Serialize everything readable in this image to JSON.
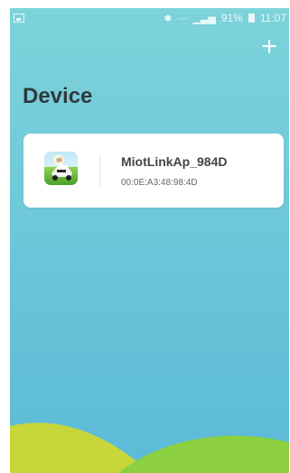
{
  "status_bar": {
    "battery_percent": "91%",
    "time": "11:07",
    "icons": [
      "image-icon",
      "bluetooth-icon",
      "wifi-icon",
      "signal-icon",
      "battery-icon"
    ]
  },
  "header": {
    "title": "Device",
    "add_icon": "plus-icon"
  },
  "devices": [
    {
      "name": "MiotLinkAp_984D",
      "mac": "00:0E:A3:48:98:4D",
      "icon": "mower-thumbnail"
    }
  ],
  "colors": {
    "background_top": "#7dd3da",
    "background_bottom": "#5bbad8",
    "hill_yellow": "#c8d63a",
    "hill_green": "#8ccf3f"
  }
}
